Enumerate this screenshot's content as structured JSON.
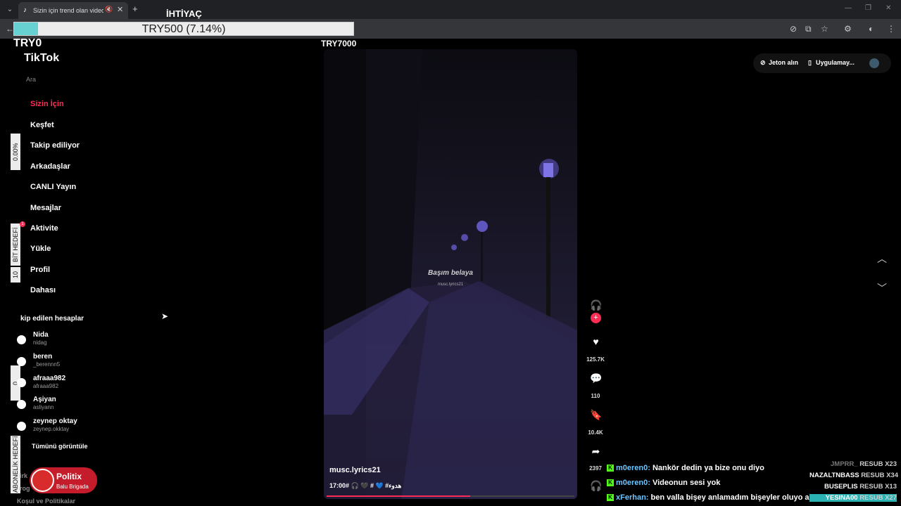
{
  "browser": {
    "tab_title": "Sizin için trend olan videolar",
    "tab_favicon": "tiktok-icon",
    "icons": [
      "menu-chevron-icon",
      "mute-icon",
      "close-icon",
      "plus-icon",
      "back-icon",
      "eye-off-icon",
      "install-icon",
      "star-icon",
      "extensions-icon",
      "profile-icon",
      "kebab-icon"
    ]
  },
  "overlay": {
    "goal_title": "İHTİYAÇ",
    "goal_text": "TRY500 (7.14%)",
    "goal_progress_pct": 7.14,
    "goal_min": "TRY0",
    "goal_max": "TRY7000",
    "bit_goal": {
      "label": "BİT HEDEFİ",
      "value": "10",
      "pct": "0.00%"
    },
    "sub_goal": {
      "label": "ABONELİK HEDEFİ",
      "value": "0"
    },
    "colors": {
      "fill": "#67d0d0",
      "highlight": "#2bb3b3"
    }
  },
  "sidebar": {
    "logo": "TikTok",
    "search_placeholder": "Ara",
    "items": [
      {
        "label": "Sizin İçin",
        "active": true
      },
      {
        "label": "Keşfet"
      },
      {
        "label": "Takip ediliyor"
      },
      {
        "label": "Arkadaşlar"
      },
      {
        "label": "CANLI Yayın"
      },
      {
        "label": "Mesajlar"
      },
      {
        "label": "Aktivite",
        "badge": "1"
      },
      {
        "label": "Yükle"
      },
      {
        "label": "Profil"
      },
      {
        "label": "Dahası"
      }
    ],
    "following_title": "kip edilen hesaplar",
    "accounts": [
      {
        "name": "Nida",
        "handle": "nidag"
      },
      {
        "name": "beren",
        "handle": "_berennn5"
      },
      {
        "name": "afraaa982",
        "handle": "afraaa982"
      },
      {
        "name": "Aşiyan",
        "handle": "asliyann"
      },
      {
        "name": "zeynep oktay",
        "handle": "zeynep.okktay"
      }
    ],
    "see_all": "Tümünü görüntüle",
    "footer": [
      "irk",
      "rog",
      "Koşul ve Politikalar"
    ],
    "sponsor": {
      "name": "Politix",
      "sub": "Balu Brigada"
    }
  },
  "video": {
    "caption": "Başım belaya",
    "caption_sub": "musc.lyrics21",
    "author": "musc.lyrics21",
    "description": "17:00# 🎧 🖤 # 💙 #هدوء",
    "progress_pct": 58
  },
  "actions": {
    "likes": "125.7K",
    "comments": "110",
    "saves": "10.4K",
    "shares": "2397"
  },
  "topbar": {
    "coins": "Jeton alın",
    "app": "Uygulamay..."
  },
  "chat": [
    {
      "user": "m0eren0:",
      "text": "Nankör dedin ya bize onu diyo"
    },
    {
      "user": "m0eren0:",
      "text": "Videonun sesi yok"
    },
    {
      "user": "xFerhan:",
      "text": "ben valla bişey anlamadım bişeyler oluyo ama"
    }
  ],
  "resubs": [
    {
      "user": "JMPRR_",
      "label": "RESUB X23",
      "style": "dim"
    },
    {
      "user": "NAZALTNBASS",
      "label": "RESUB X34",
      "style": "normal"
    },
    {
      "user": "BUSEPLIS",
      "label": "RESUB X13",
      "style": "normal"
    },
    {
      "user": "YESINA00",
      "label": "RESUB X27",
      "style": "hl"
    }
  ]
}
